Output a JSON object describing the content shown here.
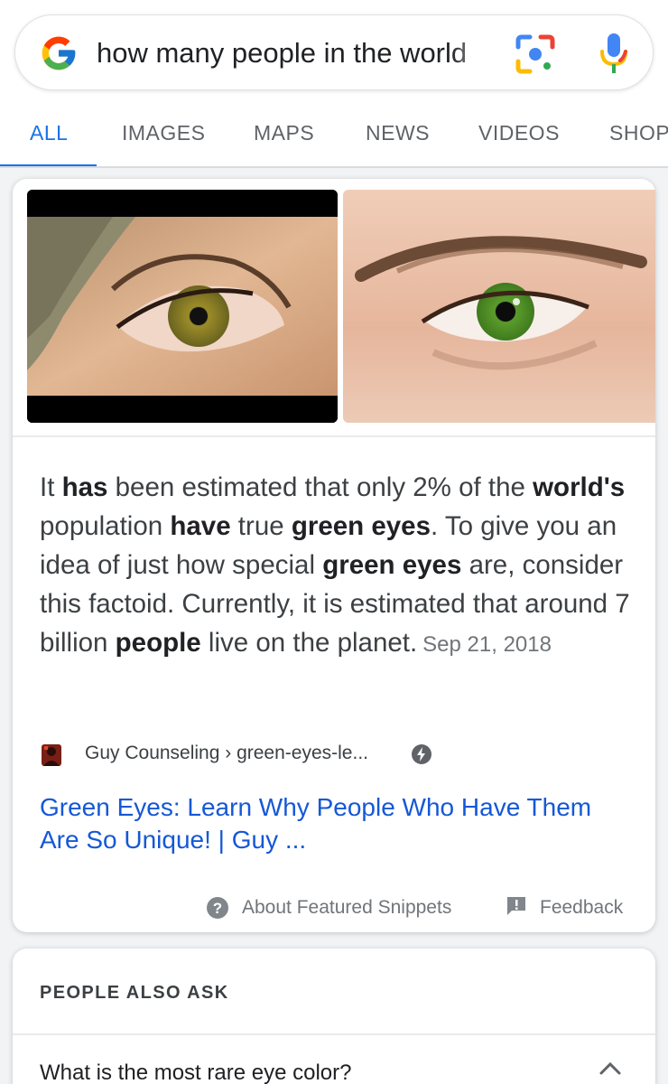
{
  "search": {
    "query": "how many people in the world"
  },
  "tabs": [
    {
      "label": "ALL",
      "active": true
    },
    {
      "label": "IMAGES"
    },
    {
      "label": "MAPS"
    },
    {
      "label": "NEWS"
    },
    {
      "label": "VIDEOS"
    },
    {
      "label": "SHOP"
    }
  ],
  "snippet": {
    "text_parts": [
      {
        "text": "It ",
        "bold": false
      },
      {
        "text": "has",
        "bold": true
      },
      {
        "text": " been estimated that only 2% of the ",
        "bold": false
      },
      {
        "text": "world's",
        "bold": true
      },
      {
        "text": " population ",
        "bold": false
      },
      {
        "text": "have",
        "bold": true
      },
      {
        "text": " true ",
        "bold": false
      },
      {
        "text": "green eyes",
        "bold": true
      },
      {
        "text": ". To give you an idea of just how special ",
        "bold": false
      },
      {
        "text": "green eyes",
        "bold": true
      },
      {
        "text": " are, consider this factoid. Currently, it is estimated that around 7 billion ",
        "bold": false
      },
      {
        "text": "people",
        "bold": true
      },
      {
        "text": " live on the planet.",
        "bold": false
      }
    ],
    "date": "Sep 21, 2018",
    "source": "Guy Counseling › green-eyes-le...",
    "title": "Green Eyes: Learn Why People Who Have Them Are So Unique! | Guy ...",
    "about_label": "About Featured Snippets",
    "feedback_label": "Feedback"
  },
  "people_also_ask": {
    "heading": "PEOPLE ALSO ASK",
    "questions": [
      "What is the most rare eye color?"
    ]
  },
  "colors": {
    "accent": "#1a73e8",
    "link": "#1558d6",
    "eye_green": "#5a9a2a"
  }
}
